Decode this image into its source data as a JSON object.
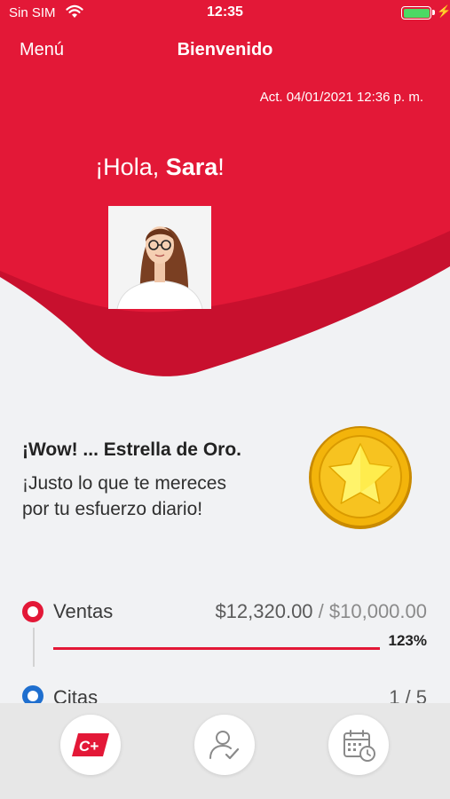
{
  "status_bar": {
    "carrier": "Sin SIM",
    "time": "12:35",
    "charging_glyph": "⚡"
  },
  "header": {
    "menu_label": "Menú",
    "title": "Bienvenido",
    "updated": "Act. 04/01/2021 12:36 p. m."
  },
  "greeting": {
    "prefix": "¡Hola, ",
    "name": "Sara",
    "suffix": "!"
  },
  "award": {
    "title": "¡Wow! ... Estrella de Oro.",
    "line1": "¡Justo lo que te mereces",
    "line2": "por tu esfuerzo diario!",
    "icon": "gold-star-medal-icon"
  },
  "metrics": {
    "ventas": {
      "label": "Ventas",
      "current": "$12,320.00",
      "separator": " / ",
      "goal": "$10,000.00",
      "percent": "123%",
      "progress_fraction": 1.0
    },
    "citas": {
      "label": "Citas",
      "value": "1 / 5"
    }
  },
  "tab_bar": {
    "tabs": [
      {
        "icon": "c-plus-logo-icon",
        "glyph": "C+"
      },
      {
        "icon": "user-check-icon"
      },
      {
        "icon": "calendar-clock-icon"
      }
    ]
  },
  "colors": {
    "brand_red": "#e31837",
    "brand_red_dark": "#c8102e",
    "citas_blue": "#1f6fcf",
    "tab_bar_bg": "#e7e7e7",
    "page_bg": "#f1f2f4"
  }
}
